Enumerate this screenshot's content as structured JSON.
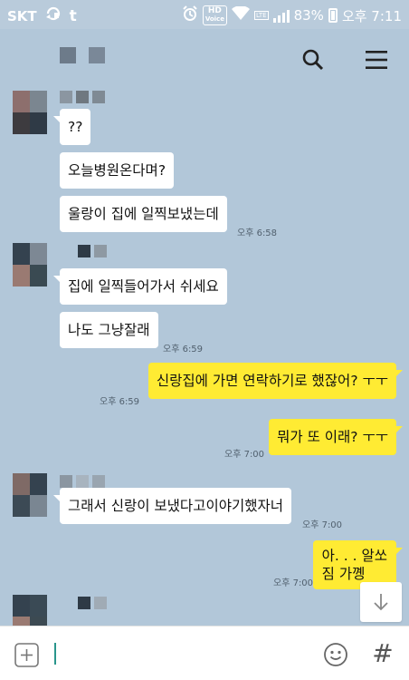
{
  "status_bar": {
    "carrier": "SKT",
    "hd_voice_top": "HD",
    "hd_voice_bottom": "Voice",
    "lte": "LTE",
    "battery": "83%",
    "time": "오후 7:11"
  },
  "header": {
    "icons": [
      "search-icon",
      "menu-icon"
    ]
  },
  "messages": [
    {
      "side": "in",
      "text": "??"
    },
    {
      "side": "in",
      "text": "오늘병원온다며?"
    },
    {
      "side": "in",
      "text": "울랑이 집에 일찍보냈는데",
      "time": "오후 6:58"
    },
    {
      "side": "in",
      "text": "집에 일찍들어가서 쉬세요"
    },
    {
      "side": "in",
      "text": "나도 그냥잘래",
      "time": "오후 6:59"
    },
    {
      "side": "out",
      "text": "신랑집에 가면 연락하기로 했잖어? ㅜㅜ",
      "time": "오후 6:59"
    },
    {
      "side": "out",
      "text": "뭐가 또 이래? ㅜㅜ",
      "time": "오후 7:00"
    },
    {
      "side": "in",
      "text": "그래서 신랑이 보냈다고이야기했자너",
      "time": "오후 7:00"
    },
    {
      "side": "out",
      "text_line1": "아. . . 알쏘",
      "text_line2": "짐 가꼥",
      "time": "오후 7:00"
    }
  ],
  "input": {
    "placeholder": ""
  },
  "colors": {
    "chat_background": "#b2c7d9",
    "incoming_bubble": "#ffffff",
    "outgoing_bubble": "#ffeb33",
    "caret": "#29958c"
  }
}
